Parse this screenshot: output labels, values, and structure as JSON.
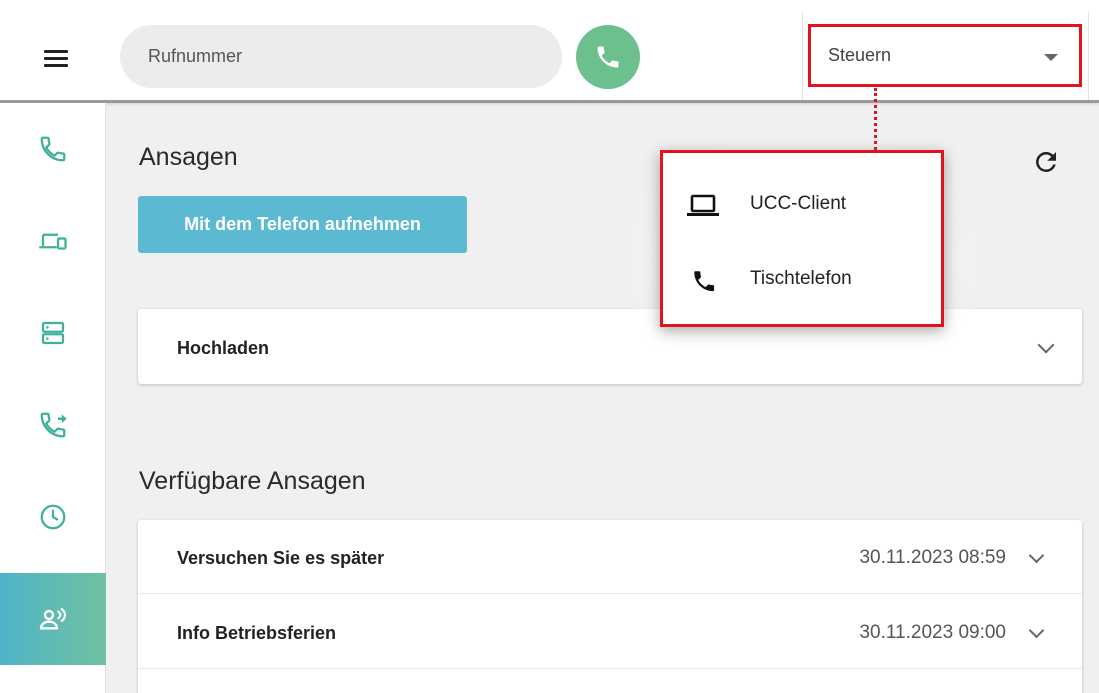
{
  "topbar": {
    "search": {
      "placeholder": "Rufnummer",
      "value": ""
    },
    "select": {
      "value": "Steuern"
    }
  },
  "sidebar": {
    "items": [
      {
        "icon": "phone-icon",
        "active": false
      },
      {
        "icon": "devices-icon",
        "active": false
      },
      {
        "icon": "server-icon",
        "active": false
      },
      {
        "icon": "call-forward-icon",
        "active": false
      },
      {
        "icon": "clock-icon",
        "active": false
      },
      {
        "icon": "announcement-icon",
        "active": true
      }
    ]
  },
  "main": {
    "title": "Ansagen",
    "record_button": "Mit dem Telefon aufnehmen",
    "upload_card": {
      "label": "Hochladen"
    },
    "available_title": "Verfügbare Ansagen",
    "announcements": [
      {
        "title": "Versuchen Sie es später",
        "date": "30.11.2023 08:59"
      },
      {
        "title": "Info Betriebsferien",
        "date": "30.11.2023 09:00"
      }
    ]
  },
  "menu": {
    "items": [
      {
        "label": "UCC-Client",
        "icon": "laptop-icon"
      },
      {
        "label": "Tischtelefon",
        "icon": "phone-icon"
      }
    ]
  },
  "colors": {
    "accent_green": "#6cc08d",
    "accent_blue": "#5bb9d2",
    "highlight_red": "#e0141e",
    "icon_teal": "#3fb09a"
  }
}
